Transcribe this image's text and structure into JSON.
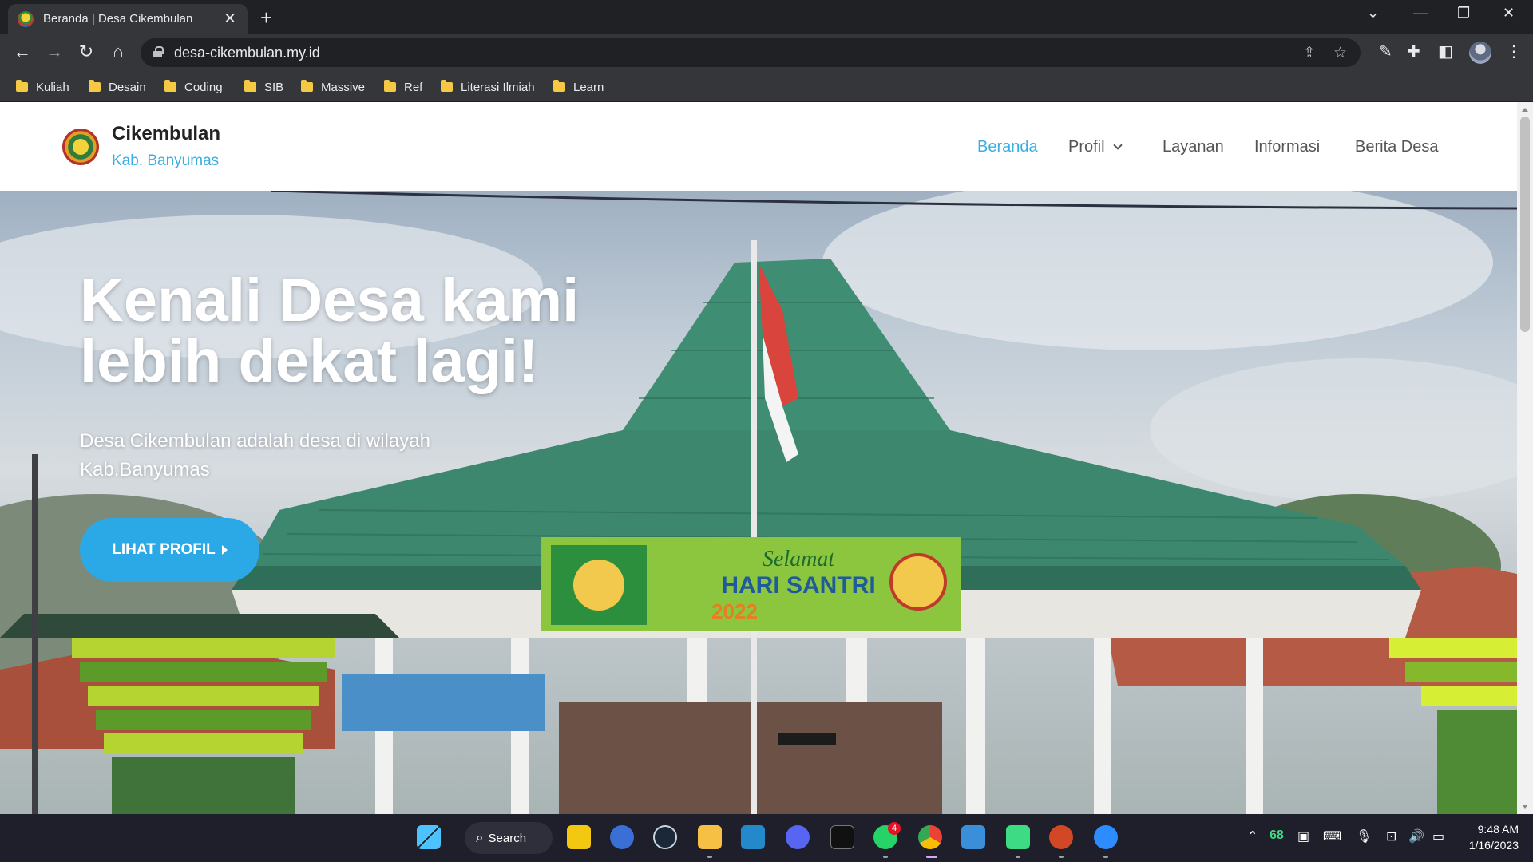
{
  "browser": {
    "tab_title": "Beranda | Desa Cikembulan",
    "url": "desa-cikembulan.my.id",
    "bookmarks": [
      "Kuliah",
      "Desain",
      "Coding",
      "SIB",
      "Massive",
      "Ref",
      "Literasi Ilmiah",
      "Learn"
    ]
  },
  "site": {
    "brand_name": "Cikembulan",
    "brand_sub": "Kab. Banyumas",
    "nav": [
      "Beranda",
      "Profil",
      "Layanan",
      "Informasi",
      "Berita Desa"
    ],
    "accent_color": "#3aaee3"
  },
  "hero": {
    "title": "Kenali Desa kami lebih dekat lagi!",
    "description": "Desa Cikembulan adalah desa di wilayah Kab.Banyumas",
    "button_label": "LIHAT PROFIL",
    "banner_heading": "Selamat",
    "banner_title": "HARI SANTRI",
    "banner_year": "2022"
  },
  "taskbar": {
    "search_label": "Search",
    "whatsapp_badge": "4",
    "weather_temp": "68",
    "time": "9:48 AM",
    "date": "1/16/2023"
  }
}
